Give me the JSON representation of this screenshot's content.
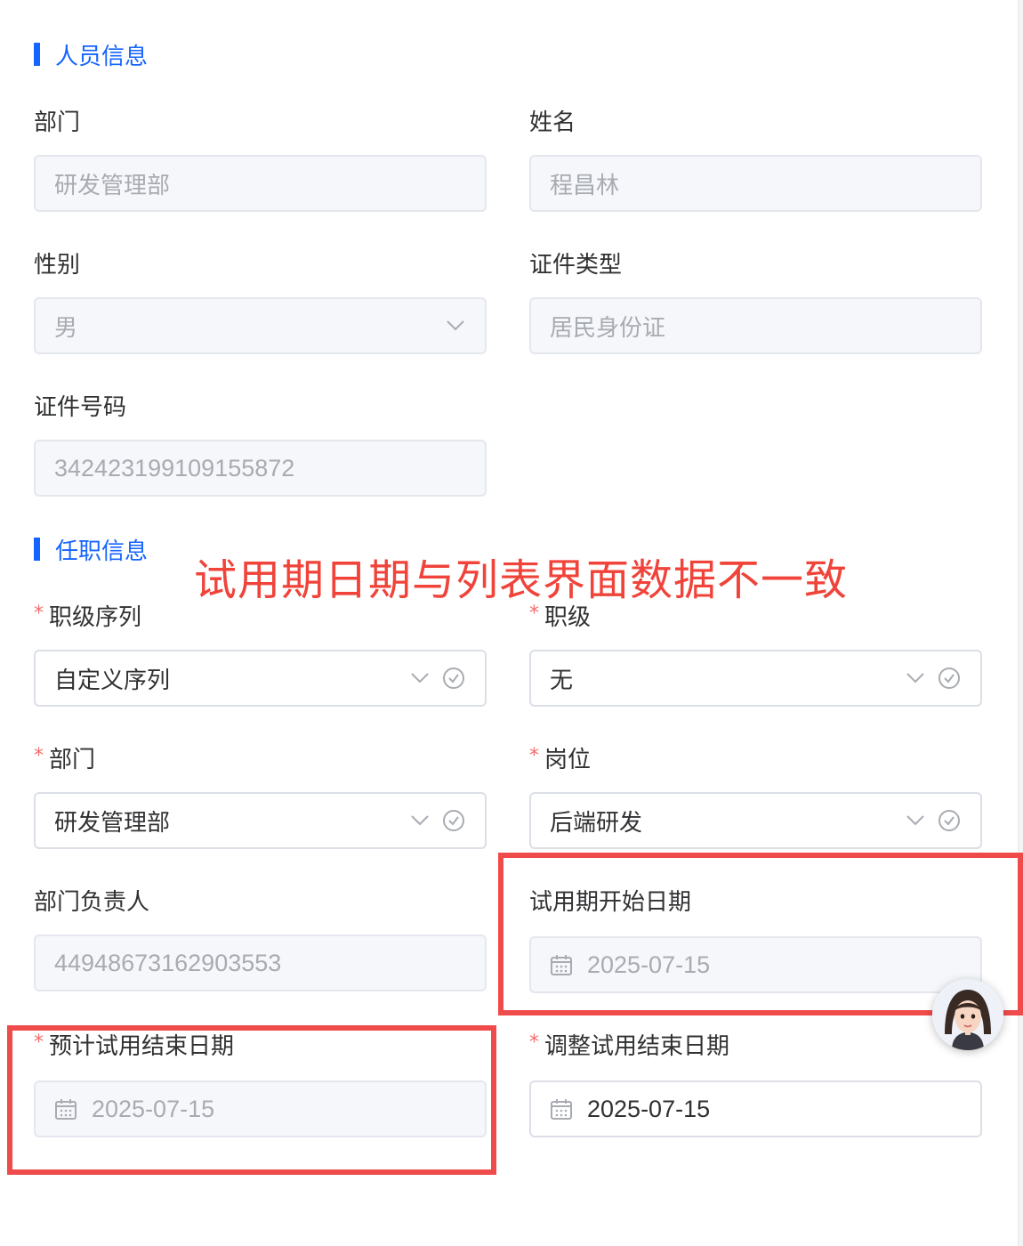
{
  "personnel_section": {
    "title": "人员信息",
    "department": {
      "label": "部门",
      "value": "研发管理部"
    },
    "name": {
      "label": "姓名",
      "value": "程昌林"
    },
    "gender": {
      "label": "性别",
      "value": "男"
    },
    "id_type": {
      "label": "证件类型",
      "value": "居民身份证"
    },
    "id_number": {
      "label": "证件号码",
      "value": "342423199109155872"
    }
  },
  "employment_section": {
    "title": "任职信息",
    "required_mark": "*",
    "job_sequence": {
      "label": "职级序列",
      "value": "自定义序列"
    },
    "job_level": {
      "label": "职级",
      "value": "无"
    },
    "department": {
      "label": "部门",
      "value": "研发管理部"
    },
    "position": {
      "label": "岗位",
      "value": "后端研发"
    },
    "dept_head": {
      "label": "部门负责人",
      "value": "44948673162903553"
    },
    "probation_start": {
      "label": "试用期开始日期",
      "value": "2025-07-15"
    },
    "expected_probation_end": {
      "label": "预计试用结束日期",
      "value": "2025-07-15"
    },
    "adjusted_probation_end": {
      "label": "调整试用结束日期",
      "value": "2025-07-15"
    }
  },
  "annotation": {
    "text": "试用期日期与列表界面数据不一致",
    "color": "#f0433a"
  },
  "colors": {
    "accent": "#1664ff",
    "required": "#f56c6c",
    "highlight_box": "#f04b4b"
  },
  "icons": [
    "chevron-down-icon",
    "check-circle-icon",
    "calendar-icon",
    "assistant-avatar"
  ]
}
